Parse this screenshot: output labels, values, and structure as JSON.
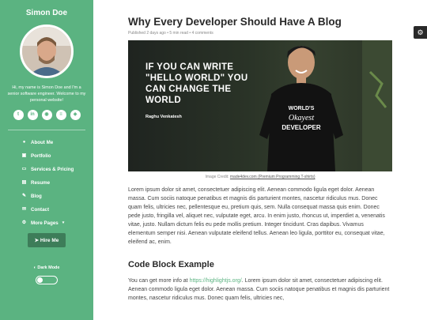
{
  "sidebar": {
    "site_name": "Simon Doe",
    "bio": "Hi, my name is Simon Doe and I'm a senior software engineer. Welcome to my personal website!",
    "social": [
      "twitter-icon",
      "linkedin-icon",
      "github-icon",
      "stackoverflow-icon",
      "codepen-icon"
    ],
    "nav": [
      {
        "icon": "user-icon",
        "label": "About Me"
      },
      {
        "icon": "briefcase-icon",
        "label": "Portfolio"
      },
      {
        "icon": "laptop-code-icon",
        "label": "Services & Pricing"
      },
      {
        "icon": "file-icon",
        "label": "Resume"
      },
      {
        "icon": "blog-icon",
        "label": "Blog"
      },
      {
        "icon": "envelope-icon",
        "label": "Contact"
      },
      {
        "icon": "cogs-icon",
        "label": "More Pages",
        "dropdown": true
      }
    ],
    "hire_label": "Hire Me",
    "dark_mode_label": "Dark Mode",
    "dark_mode_on": false
  },
  "post": {
    "title": "Why Every Developer Should Have A Blog",
    "meta": "Published 2 days ago   •   5 min read   •   4 comments",
    "image_quote": [
      "IF YOU CAN WRITE",
      "\"HELLO WORLD\" YOU",
      "CAN CHANGE THE",
      "WORLD"
    ],
    "image_author": "Raghu Venkatesh",
    "shirt_text": [
      "WORLD'S",
      "Okayest",
      "DEVELOPER"
    ],
    "credit_prefix": "Image Credit: ",
    "credit_link": "made4dev.com (Premium Programming T-shirts)",
    "paragraph1": "Lorem ipsum dolor sit amet, consectetuer adipiscing elit. Aenean commodo ligula eget dolor. Aenean massa. Cum sociis natoque penatibus et magnis dis parturient montes, nascetur ridiculus mus. Donec quam felis, ultricies nec, pellentesque eu, pretium quis, sem. Nulla consequat massa quis enim. Donec pede justo, fringilla vel, aliquet nec, vulputate eget, arcu. In enim justo, rhoncus ut, imperdiet a, venenatis vitae, justo. Nullam dictum felis eu pede mollis pretium. Integer tincidunt. Cras dapibus. Vivamus elementum semper nisi. Aenean vulputate eleifend tellus. Aenean leo ligula, porttitor eu, consequat vitae, eleifend ac, enim.",
    "heading2": "Code Block Example",
    "p2_prefix": "You can get more info at ",
    "p2_link": "https://highlightjs.org/",
    "p2_suffix": ". Lorem ipsum dolor sit amet, consectetuer adipiscing elit. Aenean commodo ligula eget dolor. Aenean massa. Cum sociis natoque penatibus et magnis dis parturient montes, nascetur ridiculus mus. Donec quam felis, ultricies nec,"
  },
  "settings_icon": "gear-icon",
  "colors": {
    "accent": "#5bb381",
    "button_dark": "#3d7d59",
    "text_dark": "#292929"
  }
}
